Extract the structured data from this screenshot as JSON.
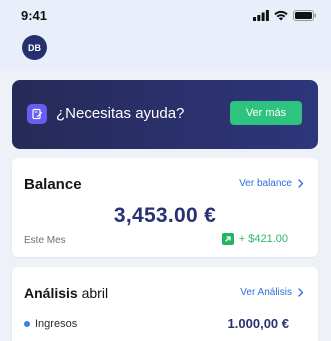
{
  "status_bar": {
    "time": "9:41"
  },
  "header": {
    "avatar_initials": "DB"
  },
  "help_banner": {
    "text": "¿Necesitas ayuda?",
    "button_label": "Ver más"
  },
  "balance": {
    "title": "Balance",
    "link_label": "Ver balance",
    "amount": "3,453.00 €",
    "period": "Este Mes",
    "change": "+ $421.00"
  },
  "analysis": {
    "title_bold": "Análisis",
    "title_month": "abril",
    "link_label": "Ver Análisis",
    "rows": [
      {
        "label": "Ingresos",
        "value": "1.000,00 €"
      }
    ]
  },
  "colors": {
    "brand_navy": "#283273",
    "accent_green": "#2ec37f",
    "link_blue": "#2f6fe0",
    "help_icon_purple": "#6a5cf0"
  },
  "icons": {
    "status": [
      "signal-icon",
      "wifi-icon",
      "battery-icon"
    ],
    "help": "help-document-icon",
    "link": "chevron-right-icon",
    "change": "arrow-up-right-icon"
  }
}
